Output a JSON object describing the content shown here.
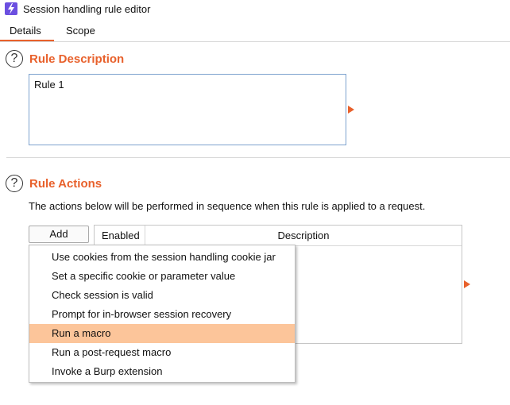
{
  "window": {
    "title": "Session handling rule editor",
    "icon": "lightning-bolt-icon",
    "accent_color": "#e8612c"
  },
  "tabs": [
    {
      "label": "Details",
      "active": true
    },
    {
      "label": "Scope",
      "active": false
    }
  ],
  "rule_description": {
    "title": "Rule Description",
    "value": "Rule 1"
  },
  "rule_actions": {
    "title": "Rule Actions",
    "description": "The actions below will be performed in sequence when this rule is applied to a request.",
    "add_label": "Add",
    "table": {
      "columns": [
        "Enabled",
        "Description"
      ],
      "rows": []
    }
  },
  "add_menu": {
    "items": [
      {
        "label": "Use cookies from the session handling cookie jar",
        "highlighted": false
      },
      {
        "label": "Set a specific cookie or parameter value",
        "highlighted": false
      },
      {
        "label": "Check session is valid",
        "highlighted": false
      },
      {
        "label": "Prompt for in-browser session recovery",
        "highlighted": false
      },
      {
        "label": "Run a macro",
        "highlighted": true
      },
      {
        "label": "Run a post-request macro",
        "highlighted": false
      },
      {
        "label": "Invoke a Burp extension",
        "highlighted": false
      }
    ]
  }
}
